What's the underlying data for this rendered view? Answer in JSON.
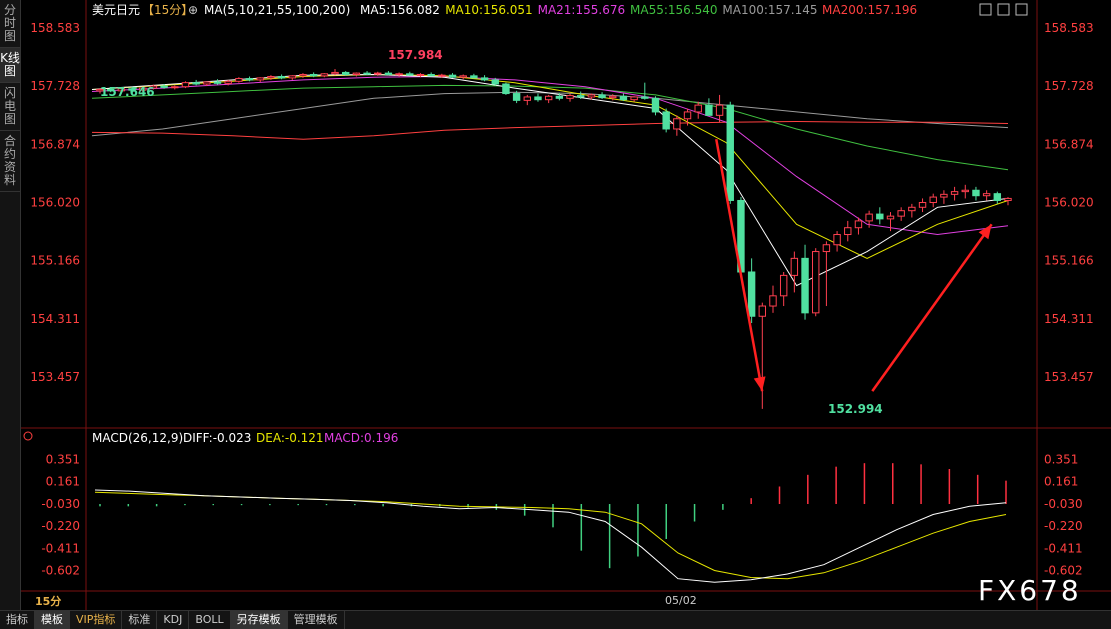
{
  "sidebar": {
    "items": [
      {
        "label": "分时图"
      },
      {
        "label": "K线图"
      },
      {
        "label": "闪电图"
      },
      {
        "label": "合约资料"
      }
    ]
  },
  "price_panel": {
    "symbol": "美元日元",
    "period": "【15分】",
    "ma_params": "MA(5,10,21,55,100,200)",
    "ma_labels": [
      {
        "text": "MA5:156.082",
        "color": "#ffffff"
      },
      {
        "text": "MA10:156.051",
        "color": "#e6e600"
      },
      {
        "text": "MA21:155.676",
        "color": "#e040e0"
      },
      {
        "text": "MA55:156.540",
        "color": "#40c040"
      },
      {
        "text": "MA100:157.145",
        "color": "#9a9a9a"
      },
      {
        "text": "MA200:157.196",
        "color": "#ff4040"
      }
    ],
    "high_label": "157.984",
    "low_label": "152.994",
    "left_label": "157.646"
  },
  "macd_panel": {
    "title": "MACD(26,12,9)",
    "diff": "DIFF:-0.023",
    "dea": "DEA:-0.121",
    "macd": "MACD:0.196"
  },
  "date_label": "05/02",
  "period_label": "15分",
  "bottom_tabs": [
    {
      "label": "指标"
    },
    {
      "label": "模板"
    },
    {
      "label": "VIP指标"
    },
    {
      "label": "标准"
    },
    {
      "label": "KDJ"
    },
    {
      "label": "BOLL"
    },
    {
      "label": "另存模板"
    },
    {
      "label": "管理模板"
    }
  ],
  "watermark": "FX678",
  "chart_data": [
    {
      "type": "candlestick",
      "y_ticks": [
        158.583,
        157.728,
        156.874,
        156.02,
        155.166,
        154.311,
        153.457
      ],
      "ylim": [
        152.9,
        158.7
      ],
      "x_ticks": [
        "05/02"
      ],
      "candles": [
        [
          157.66,
          157.7,
          157.62,
          157.68
        ],
        [
          157.68,
          157.71,
          157.64,
          157.66
        ],
        [
          157.66,
          157.7,
          157.63,
          157.69
        ],
        [
          157.69,
          157.72,
          157.65,
          157.67
        ],
        [
          157.67,
          157.72,
          157.64,
          157.7
        ],
        [
          157.7,
          157.75,
          157.68,
          157.73
        ],
        [
          157.73,
          157.76,
          157.69,
          157.71
        ],
        [
          157.71,
          157.74,
          157.68,
          157.72
        ],
        [
          157.72,
          157.8,
          157.7,
          157.78
        ],
        [
          157.78,
          157.82,
          157.74,
          157.76
        ],
        [
          157.76,
          157.8,
          157.73,
          157.79
        ],
        [
          157.79,
          157.83,
          157.75,
          157.77
        ],
        [
          157.77,
          157.82,
          157.74,
          157.8
        ],
        [
          157.8,
          157.86,
          157.78,
          157.84
        ],
        [
          157.84,
          157.87,
          157.8,
          157.82
        ],
        [
          157.82,
          157.86,
          157.79,
          157.85
        ],
        [
          157.85,
          157.89,
          157.82,
          157.87
        ],
        [
          157.87,
          157.9,
          157.83,
          157.85
        ],
        [
          157.85,
          157.89,
          157.82,
          157.88
        ],
        [
          157.88,
          157.92,
          157.85,
          157.9
        ],
        [
          157.9,
          157.93,
          157.86,
          157.88
        ],
        [
          157.88,
          157.92,
          157.86,
          157.91
        ],
        [
          157.91,
          157.98,
          157.89,
          157.93
        ],
        [
          157.93,
          157.95,
          157.88,
          157.9
        ],
        [
          157.9,
          157.93,
          157.87,
          157.92
        ],
        [
          157.92,
          157.95,
          157.89,
          157.91
        ],
        [
          157.91,
          157.94,
          157.88,
          157.92
        ],
        [
          157.92,
          157.95,
          157.89,
          157.9
        ],
        [
          157.9,
          157.93,
          157.87,
          157.91
        ],
        [
          157.91,
          157.94,
          157.88,
          157.89
        ],
        [
          157.89,
          157.92,
          157.86,
          157.9
        ],
        [
          157.9,
          157.93,
          157.87,
          157.88
        ],
        [
          157.88,
          157.91,
          157.85,
          157.89
        ],
        [
          157.89,
          157.92,
          157.85,
          157.86
        ],
        [
          157.86,
          157.9,
          157.83,
          157.88
        ],
        [
          157.88,
          157.91,
          157.84,
          157.85
        ],
        [
          157.85,
          157.89,
          157.8,
          157.82
        ],
        [
          157.82,
          157.85,
          157.74,
          157.76
        ],
        [
          157.76,
          157.78,
          157.6,
          157.62
        ],
        [
          157.62,
          157.66,
          157.48,
          157.52
        ],
        [
          157.52,
          157.6,
          157.45,
          157.57
        ],
        [
          157.57,
          157.62,
          157.5,
          157.53
        ],
        [
          157.53,
          157.6,
          157.48,
          157.58
        ],
        [
          157.58,
          157.63,
          157.52,
          157.55
        ],
        [
          157.55,
          157.62,
          157.5,
          157.59
        ],
        [
          157.59,
          157.65,
          157.54,
          157.57
        ],
        [
          157.57,
          157.62,
          157.53,
          157.6
        ],
        [
          157.6,
          157.64,
          157.54,
          157.56
        ],
        [
          157.56,
          157.61,
          157.52,
          157.58
        ],
        [
          157.58,
          157.62,
          157.51,
          157.53
        ],
        [
          157.53,
          157.58,
          157.5,
          157.57
        ],
        [
          157.57,
          157.78,
          157.53,
          157.55
        ],
        [
          157.55,
          157.58,
          157.3,
          157.35
        ],
        [
          157.35,
          157.4,
          157.05,
          157.1
        ],
        [
          157.1,
          157.3,
          157.0,
          157.25
        ],
        [
          157.25,
          157.4,
          157.15,
          157.35
        ],
        [
          157.35,
          157.5,
          157.25,
          157.45
        ],
        [
          157.45,
          157.55,
          157.35,
          157.3
        ],
        [
          157.3,
          157.6,
          157.2,
          157.45
        ],
        [
          157.45,
          157.5,
          156.0,
          156.05
        ],
        [
          156.05,
          156.1,
          154.95,
          155.0
        ],
        [
          155.0,
          155.2,
          154.25,
          154.35
        ],
        [
          154.35,
          154.55,
          152.99,
          154.5
        ],
        [
          154.5,
          154.8,
          154.4,
          154.65
        ],
        [
          154.65,
          155.0,
          154.5,
          154.95
        ],
        [
          154.95,
          155.3,
          154.7,
          155.2
        ],
        [
          155.2,
          155.4,
          154.3,
          154.4
        ],
        [
          154.4,
          155.35,
          154.35,
          155.3
        ],
        [
          155.3,
          155.45,
          154.5,
          155.4
        ],
        [
          155.4,
          155.6,
          155.3,
          155.55
        ],
        [
          155.55,
          155.75,
          155.45,
          155.65
        ],
        [
          155.65,
          155.8,
          155.55,
          155.75
        ],
        [
          155.75,
          155.9,
          155.65,
          155.85
        ],
        [
          155.85,
          155.95,
          155.7,
          155.78
        ],
        [
          155.78,
          155.88,
          155.6,
          155.82
        ],
        [
          155.82,
          155.95,
          155.75,
          155.9
        ],
        [
          155.9,
          156.0,
          155.8,
          155.95
        ],
        [
          155.95,
          156.08,
          155.88,
          156.02
        ],
        [
          156.02,
          156.15,
          155.95,
          156.1
        ],
        [
          156.1,
          156.2,
          156.0,
          156.14
        ],
        [
          156.14,
          156.25,
          156.05,
          156.18
        ],
        [
          156.18,
          156.28,
          156.08,
          156.2
        ],
        [
          156.2,
          156.25,
          156.05,
          156.12
        ],
        [
          156.12,
          156.2,
          156.05,
          156.15
        ],
        [
          156.15,
          156.18,
          156.0,
          156.05
        ],
        [
          156.05,
          156.1,
          155.98,
          156.08
        ]
      ],
      "arrows": [
        {
          "from": [
            0.68,
            156.95
          ],
          "to": [
            0.73,
            153.25
          ]
        },
        {
          "from": [
            0.76,
            153.5
          ],
          "to": [
            0.93,
            155.8
          ]
        },
        {
          "from": [
            0.85,
            153.25
          ],
          "to": [
            0.98,
            155.7
          ]
        }
      ],
      "ma_series": [
        {
          "name": "MA100",
          "color": "#9a9a9a",
          "values": [
            157.0,
            157.1,
            157.25,
            157.4,
            157.55,
            157.62,
            157.64,
            157.62,
            157.55,
            157.45,
            157.35,
            157.25,
            157.18,
            157.12
          ]
        },
        {
          "name": "MA200",
          "color": "#ff4040",
          "values": [
            157.05,
            157.04,
            157.0,
            156.95,
            157.0,
            157.08,
            157.12,
            157.15,
            157.18,
            157.2,
            157.21,
            157.2,
            157.2,
            157.18
          ]
        },
        {
          "name": "MA55",
          "color": "#40c040",
          "values": [
            157.55,
            157.6,
            157.65,
            157.7,
            157.72,
            157.74,
            157.73,
            157.7,
            157.6,
            157.4,
            157.1,
            156.85,
            156.65,
            156.5
          ]
        },
        {
          "name": "MA21",
          "color": "#e040e0",
          "values": [
            157.65,
            157.7,
            157.76,
            157.82,
            157.86,
            157.87,
            157.82,
            157.72,
            157.55,
            157.2,
            156.4,
            155.7,
            155.55,
            155.68
          ]
        },
        {
          "name": "MA10",
          "color": "#e6e600",
          "values": [
            157.68,
            157.74,
            157.8,
            157.87,
            157.9,
            157.88,
            157.78,
            157.6,
            157.45,
            156.9,
            155.7,
            155.2,
            155.7,
            156.05
          ]
        },
        {
          "name": "MA5",
          "color": "#ffffff",
          "values": [
            157.68,
            157.75,
            157.82,
            157.89,
            157.9,
            157.86,
            157.7,
            157.55,
            157.4,
            156.5,
            154.8,
            155.3,
            155.95,
            156.08
          ]
        }
      ]
    },
    {
      "type": "macd",
      "y_ticks": [
        0.351,
        0.161,
        -0.03,
        -0.22,
        -0.411,
        -0.602
      ],
      "ylim": [
        -0.75,
        0.45
      ],
      "diff": [
        0.09,
        0.08,
        0.06,
        0.04,
        0.03,
        0.02,
        0.01,
        0.0,
        -0.02,
        -0.05,
        -0.07,
        -0.06,
        -0.08,
        -0.1,
        -0.18,
        -0.4,
        -0.67,
        -0.7,
        -0.68,
        -0.63,
        -0.55,
        -0.4,
        -0.25,
        -0.12,
        -0.05,
        -0.02
      ],
      "dea": [
        0.07,
        0.06,
        0.05,
        0.04,
        0.03,
        0.02,
        0.01,
        0.0,
        -0.01,
        -0.03,
        -0.05,
        -0.055,
        -0.06,
        -0.07,
        -0.1,
        -0.2,
        -0.45,
        -0.6,
        -0.66,
        -0.67,
        -0.62,
        -0.52,
        -0.4,
        -0.28,
        -0.18,
        -0.12
      ],
      "hist": [
        -0.02,
        -0.02,
        -0.02,
        -0.01,
        -0.01,
        -0.01,
        -0.01,
        -0.01,
        -0.01,
        -0.01,
        -0.02,
        -0.02,
        -0.02,
        -0.03,
        -0.05,
        -0.1,
        -0.2,
        -0.4,
        -0.55,
        -0.45,
        -0.3,
        -0.15,
        -0.05,
        0.05,
        0.15,
        0.25,
        0.32,
        0.35,
        0.35,
        0.34,
        0.3,
        0.25,
        0.2
      ]
    }
  ]
}
